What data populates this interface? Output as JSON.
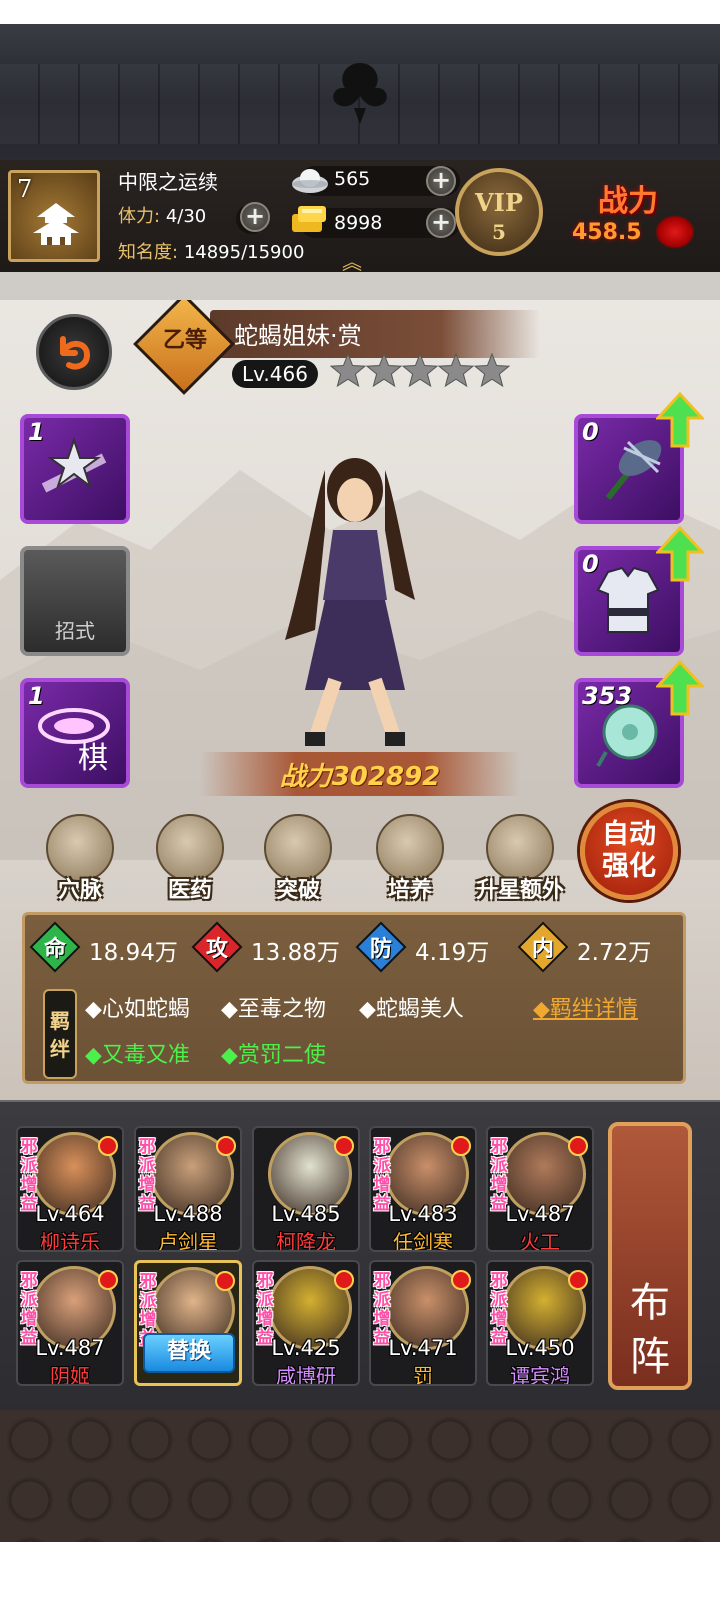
{
  "player": {
    "level": "7",
    "name": "中限之运续",
    "stamina_label": "体力:",
    "stamina_value": "4/30",
    "fame_label": "知名度:",
    "fame_value": "14895/15900"
  },
  "resources": {
    "silver": "565",
    "gold": "8998"
  },
  "vip": {
    "label": "VIP",
    "level": "5"
  },
  "team_power": {
    "label": "战力",
    "value": "458.5"
  },
  "hero": {
    "grade": "乙等",
    "name": "蛇蝎姐妹·赏",
    "level": "Lv.466",
    "stars_total": 5,
    "stars_filled": 0,
    "power": "战力302892"
  },
  "left_cards": [
    {
      "count": "1",
      "label": ""
    },
    {
      "count": "",
      "label": "招式"
    },
    {
      "count": "1",
      "label": ""
    }
  ],
  "right_cards": [
    {
      "count": "0"
    },
    {
      "count": "0"
    },
    {
      "count": "353"
    }
  ],
  "functions": [
    {
      "label": "穴脉"
    },
    {
      "label": "医药"
    },
    {
      "label": "突破"
    },
    {
      "label": "培养"
    },
    {
      "label": "升星额外"
    }
  ],
  "auto_enhance": {
    "line1": "自动",
    "line2": "强化"
  },
  "stats": [
    {
      "icon": "命",
      "value": "18.94万",
      "color": "#2db54a"
    },
    {
      "icon": "攻",
      "value": "13.88万",
      "color": "#d9262b"
    },
    {
      "icon": "防",
      "value": "4.19万",
      "color": "#2a7fd6"
    },
    {
      "icon": "内",
      "value": "2.72万",
      "color": "#e2a72c"
    }
  ],
  "bond_tag": {
    "line1": "羁",
    "line2": "绊"
  },
  "bonds_active": [
    "◆心如蛇蝎",
    "◆至毒之物",
    "◆蛇蝎美人"
  ],
  "bonds_other": [
    "◆又毒又准",
    "◆赏罚二使"
  ],
  "bond_details": "◆羁绊详情",
  "roster": [
    {
      "level": "Lv.464",
      "name": "柳诗乐",
      "name_color": "#ff3b3b",
      "tag": "邪派增益"
    },
    {
      "level": "Lv.488",
      "name": "卢剑星",
      "name_color": "#ffb938",
      "tag": "邪派增益"
    },
    {
      "level": "Lv.485",
      "name": "柯降龙",
      "name_color": "#ff3b3b",
      "tag": ""
    },
    {
      "level": "Lv.483",
      "name": "任剑寒",
      "name_color": "#ffb938",
      "tag": "邪派增益"
    },
    {
      "level": "Lv.487",
      "name": "火工",
      "name_color": "#ff3b3b",
      "tag": "邪派增益"
    },
    {
      "level": "Lv.487",
      "name": "阴姬",
      "name_color": "#ff3b3b",
      "tag": "邪派增益"
    },
    {
      "level": "",
      "name": "",
      "name_color": "#ffffff",
      "tag": "邪派增益",
      "swap": "替换"
    },
    {
      "level": "Lv.425",
      "name": "咸博研",
      "name_color": "#d48cff",
      "tag": "邪派增益"
    },
    {
      "level": "Lv.471",
      "name": "罚",
      "name_color": "#ffb938",
      "tag": "邪派增益"
    },
    {
      "level": "Lv.450",
      "name": "谭宾鸿",
      "name_color": "#d48cff",
      "tag": "邪派增益"
    }
  ],
  "formation": {
    "line1": "布",
    "line2": "阵"
  }
}
